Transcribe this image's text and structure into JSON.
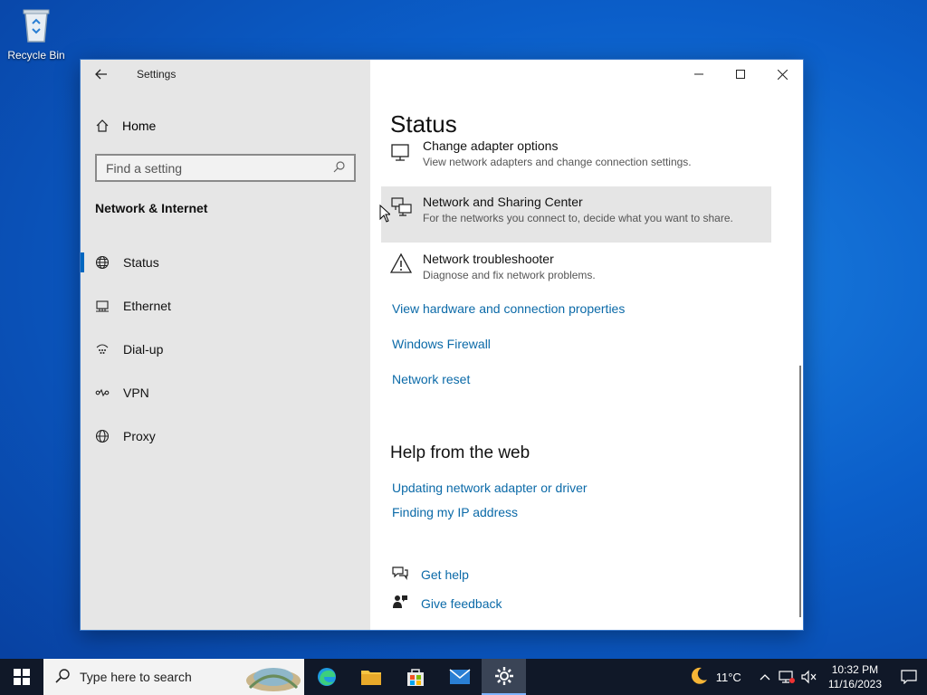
{
  "desktop": {
    "recycle_bin_label": "Recycle Bin"
  },
  "window": {
    "app_title": "Settings",
    "home_label": "Home",
    "search_placeholder": "Find a setting",
    "section_title": "Network & Internet",
    "nav_items": [
      {
        "label": "Status",
        "icon": "globe-icon",
        "active": true
      },
      {
        "label": "Ethernet",
        "icon": "ethernet-icon",
        "active": false
      },
      {
        "label": "Dial-up",
        "icon": "dialup-icon",
        "active": false
      },
      {
        "label": "VPN",
        "icon": "vpn-icon",
        "active": false
      },
      {
        "label": "Proxy",
        "icon": "globe-icon",
        "active": false
      }
    ]
  },
  "main": {
    "page_title": "Status",
    "entries": [
      {
        "title": "Change adapter options",
        "desc": "View network adapters and change connection settings.",
        "icon": "monitor-icon"
      },
      {
        "title": "Network and Sharing Center",
        "desc": "For the networks you connect to, decide what you want to share.",
        "icon": "sharing-center-icon"
      },
      {
        "title": "Network troubleshooter",
        "desc": "Diagnose and fix network problems.",
        "icon": "warning-icon"
      }
    ],
    "links": [
      "View hardware and connection properties",
      "Windows Firewall",
      "Network reset"
    ],
    "help_heading": "Help from the web",
    "help_links": [
      "Updating network adapter or driver",
      "Finding my IP address"
    ],
    "get_help": "Get help",
    "give_feedback": "Give feedback"
  },
  "taskbar": {
    "search_placeholder": "Type here to search",
    "weather": "11°C",
    "time": "10:32 PM",
    "date": "11/16/2023"
  },
  "colors": {
    "accent": "#0067c0",
    "link": "#0b6aa8",
    "taskbar": "#101828"
  }
}
